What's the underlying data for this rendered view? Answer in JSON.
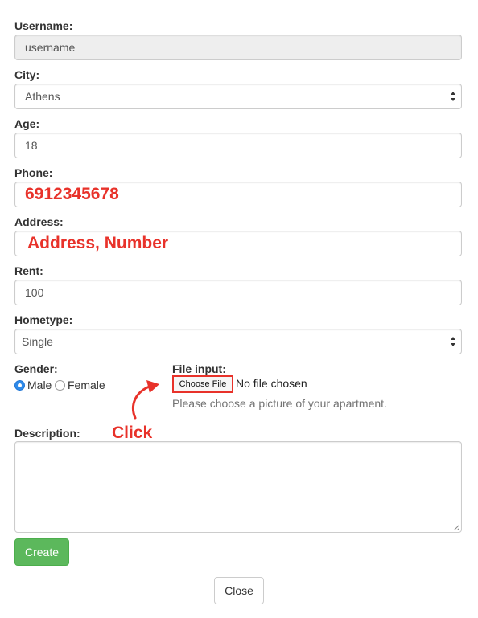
{
  "form": {
    "username": {
      "label": "Username:",
      "placeholder": "username"
    },
    "city": {
      "label": "City:",
      "value": "Athens"
    },
    "age": {
      "label": "Age:",
      "value": "18"
    },
    "phone": {
      "label": "Phone:",
      "value": "6912345678"
    },
    "address": {
      "label": "Address:",
      "value": "Address, Number"
    },
    "rent": {
      "label": "Rent:",
      "value": "100"
    },
    "hometype": {
      "label": "Hometype:",
      "value": "Single"
    },
    "gender": {
      "label": "Gender:",
      "options": [
        "Male",
        "Female"
      ],
      "selected": "Male"
    },
    "file_input": {
      "label": "File input:",
      "button_label": "Choose File",
      "status": "No file chosen",
      "help": "Please choose a picture of your apartment."
    },
    "description": {
      "label": "Description:",
      "value": ""
    }
  },
  "annotation": {
    "text": "Click",
    "color": "#e8322a"
  },
  "buttons": {
    "create": "Create",
    "close": "Close"
  },
  "colors": {
    "create_bg": "#5cb85c",
    "annotation_red": "#e8322a",
    "radio_selected": "#2f8bea"
  },
  "icons": {
    "select_arrow": "updown-arrows-icon",
    "annotation_arrow": "curved-arrow-icon"
  }
}
